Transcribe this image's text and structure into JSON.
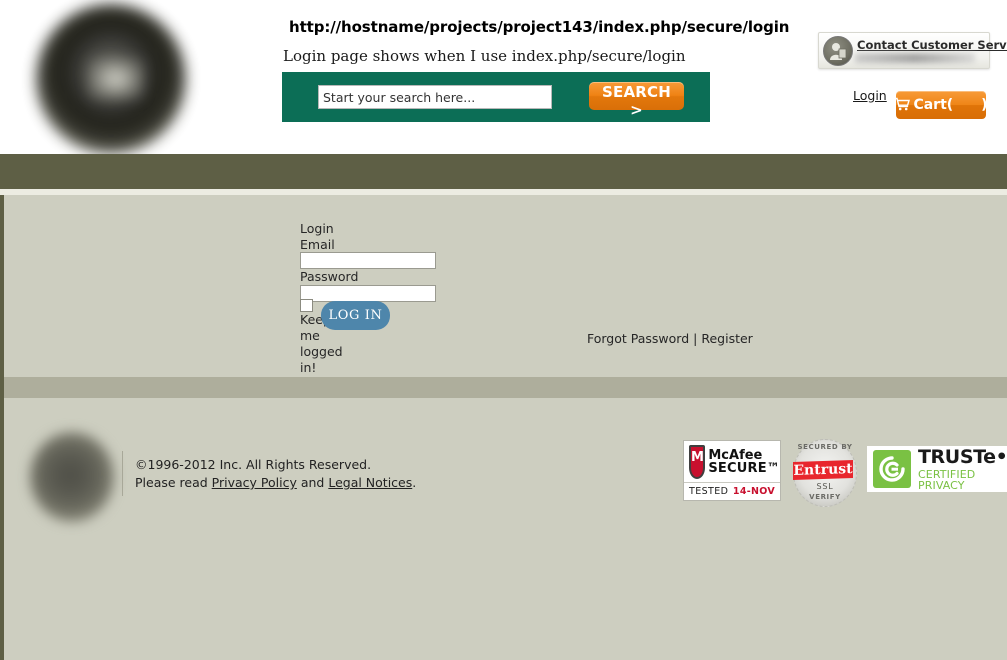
{
  "header": {
    "url_text": "http://hostname/projects/project143/index.php/secure/login",
    "note_text": "Login page shows when I use index.php/secure/login",
    "logo_name": "site-logo-globe",
    "search": {
      "placeholder": "Start your search here...",
      "value": "",
      "button_label": "SEARCH >"
    },
    "contact": {
      "label": "Contact Customer Service",
      "avatar_icon": "person-icon"
    },
    "login_link": "Login",
    "cart": {
      "icon": "shopping-cart-icon",
      "label": "Cart(",
      "count": "",
      "label_end": ")"
    }
  },
  "login_form": {
    "heading": "Login",
    "email_label": "Email",
    "email_value": "",
    "password_label": "Password",
    "password_value": "",
    "keep_logged_in_label": "Keep me logged in!",
    "submit_label": "LOG IN",
    "forgot_password": "Forgot Password",
    "links_separator": "|",
    "register": "Register"
  },
  "footer": {
    "logo_name": "footer-logo-globe",
    "copyright_line1": "©1996-2012 Inc. All Rights Reserved.",
    "please_read": "Please read ",
    "privacy_policy": "Privacy Policy",
    "and_text": " and ",
    "legal_notices": "Legal Notices",
    "period": ".",
    "badges": {
      "mcafee": {
        "shield_letter": "M",
        "line1": "McAfee",
        "line2": "SECURE™",
        "tested": "TESTED",
        "date": "14-NOV"
      },
      "entrust": {
        "top_text": "SECURED BY",
        "word": "Entrust",
        "ssl": "SSL",
        "bottom_text": "VERIFY"
      },
      "truste": {
        "line1": "TRUSTe•",
        "line2": "CERTIFIED PRIVACY"
      }
    }
  },
  "colors": {
    "nav_olive": "#5e5f45",
    "page_bg": "#cdcec0",
    "mid_band": "#aeae9c",
    "search_green": "#0c6e56",
    "accent_orange": "#ef8517",
    "login_blue": "#4e86ab",
    "mcafee_red": "#c8102e",
    "truste_green": "#7ac143",
    "entrust_red": "#e8262d"
  }
}
